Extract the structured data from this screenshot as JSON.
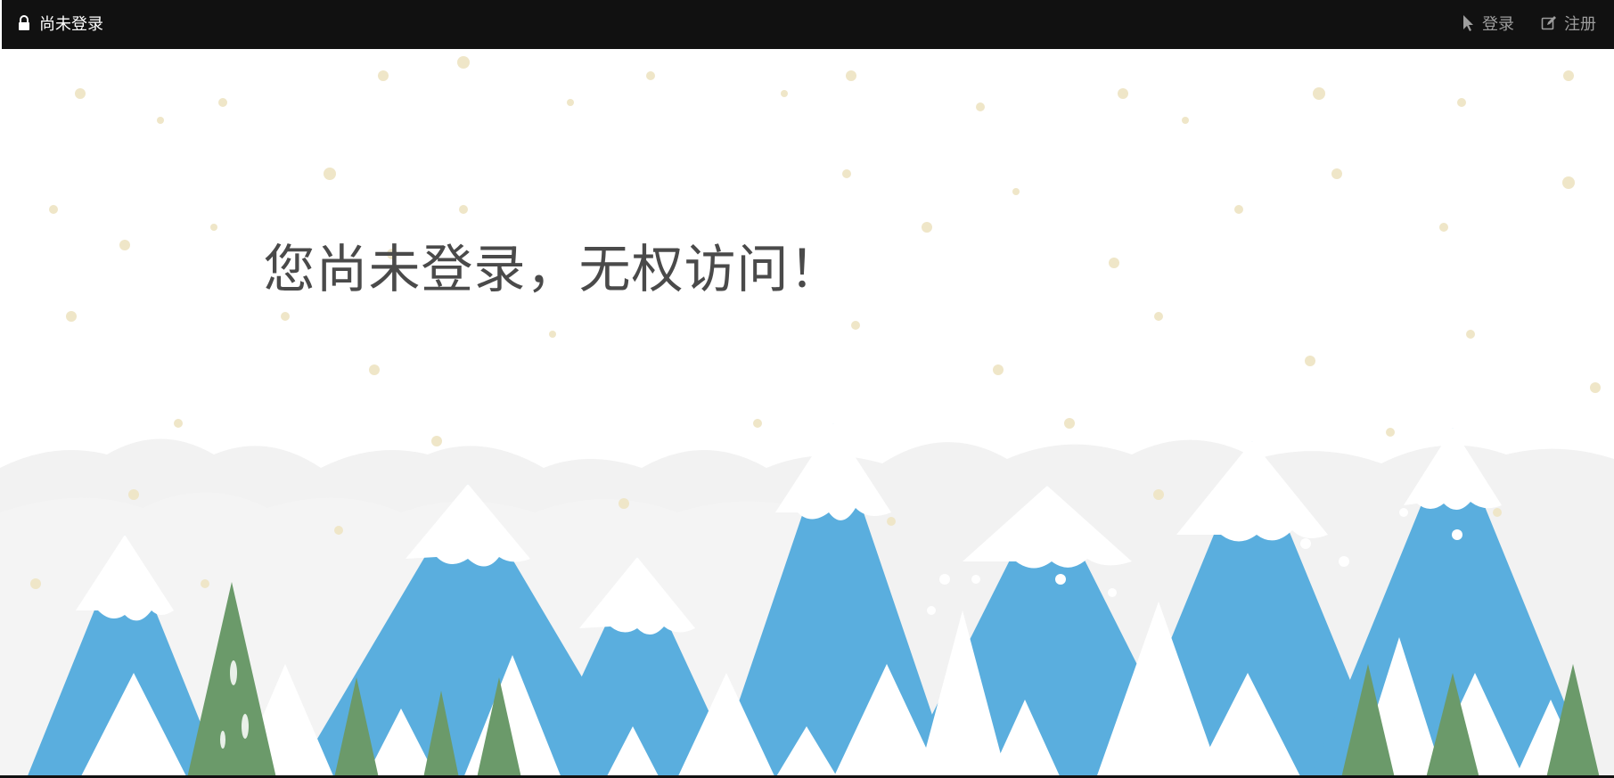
{
  "navbar": {
    "brand_label": "尚未登录",
    "brand_icon": "lock-icon",
    "links": [
      {
        "label": "登录",
        "icon": "cursor-pointer-icon"
      },
      {
        "label": "注册",
        "icon": "edit-icon"
      }
    ]
  },
  "main": {
    "message": "您尚未登录，无权访问！"
  },
  "colors": {
    "navbar_bg": "#111111",
    "nav_link": "#9d9d9d",
    "mountain_blue": "#5aaede",
    "tree_green": "#6b9a6a",
    "snow_dot": "#efe6c8"
  }
}
